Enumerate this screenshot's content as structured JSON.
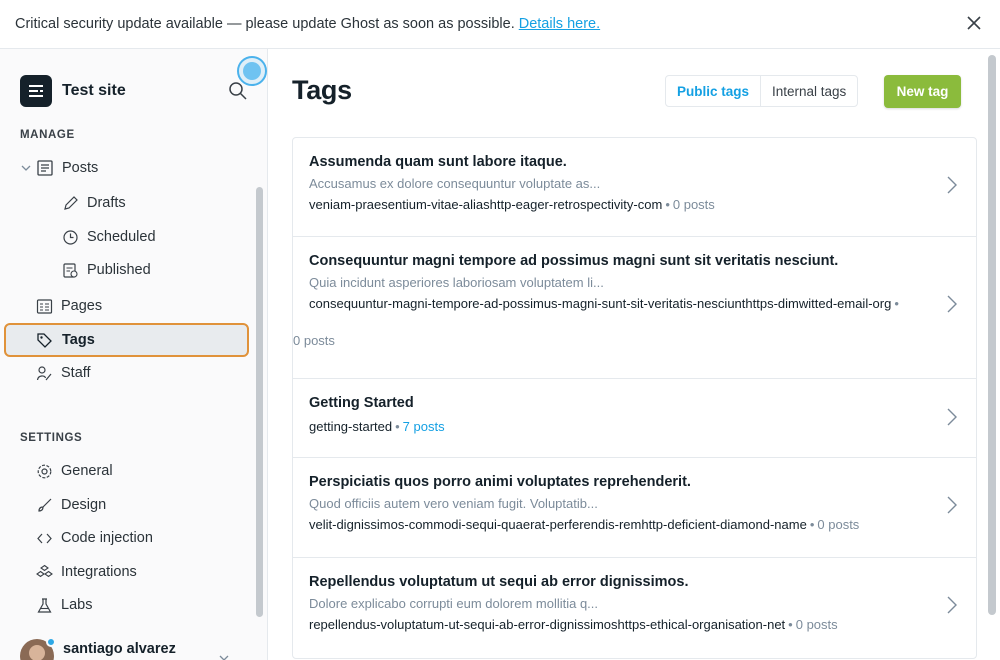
{
  "banner": {
    "message": "Critical security update available — please update Ghost as soon as possible.",
    "link": "Details here."
  },
  "sidebar": {
    "site_name": "Test site",
    "manage_label": "MANAGE",
    "settings_label": "SETTINGS",
    "manage_items": [
      {
        "label": "Posts",
        "icon": "posts-icon"
      },
      {
        "label": "Drafts",
        "icon": "pencil-icon"
      },
      {
        "label": "Scheduled",
        "icon": "clock-icon"
      },
      {
        "label": "Published",
        "icon": "published-icon"
      },
      {
        "label": "Pages",
        "icon": "pages-icon"
      },
      {
        "label": "Tags",
        "icon": "tag-icon"
      },
      {
        "label": "Staff",
        "icon": "staff-icon"
      }
    ],
    "settings_items": [
      {
        "label": "General",
        "icon": "gear-icon"
      },
      {
        "label": "Design",
        "icon": "brush-icon"
      },
      {
        "label": "Code injection",
        "icon": "code-icon"
      },
      {
        "label": "Integrations",
        "icon": "integrations-icon"
      },
      {
        "label": "Labs",
        "icon": "flask-icon"
      }
    ],
    "user_name": "santiago alvarez"
  },
  "main": {
    "title": "Tags",
    "filter_public": "Public tags",
    "filter_internal": "Internal tags",
    "new_tag_label": "New tag",
    "tags": [
      {
        "name": "Assumenda quam sunt labore itaque.",
        "description": "Accusamus ex dolore consequuntur voluptate as...",
        "slug": "veniam-praesentium-vitae-aliashttp-eager-retrospectivity-com",
        "count": "0 posts"
      },
      {
        "name": "Consequuntur magni tempore ad possimus magni sunt sit veritatis nesciunt.",
        "description": "Quia incidunt asperiores laboriosam voluptatem li...",
        "slug": "consequuntur-magni-tempore-ad-possimus-magni-sunt-sit-veritatis-nesciunthttps-dimwitted-email-org",
        "count": "0 posts"
      },
      {
        "name": "Getting Started",
        "description": "",
        "slug": "getting-started",
        "count": "7 posts"
      },
      {
        "name": "Perspiciatis quos porro animi voluptates reprehenderit.",
        "description": "Quod officiis autem vero veniam fugit. Voluptatib...",
        "slug": "velit-dignissimos-commodi-sequi-quaerat-perferendis-remhttp-deficient-diamond-name",
        "count": "0 posts"
      },
      {
        "name": "Repellendus voluptatum ut sequi ab error dignissimos.",
        "description": "Dolore explicabo corrupti eum dolorem mollitia q...",
        "slug": "repellendus-voluptatum-ut-sequi-ab-error-dignissimoshttps-ethical-organisation-net",
        "count": "0 posts"
      }
    ]
  },
  "colors": {
    "accent": "#14a0e3",
    "new_button": "#8bbb3c",
    "active_outline": "#e0923a"
  }
}
